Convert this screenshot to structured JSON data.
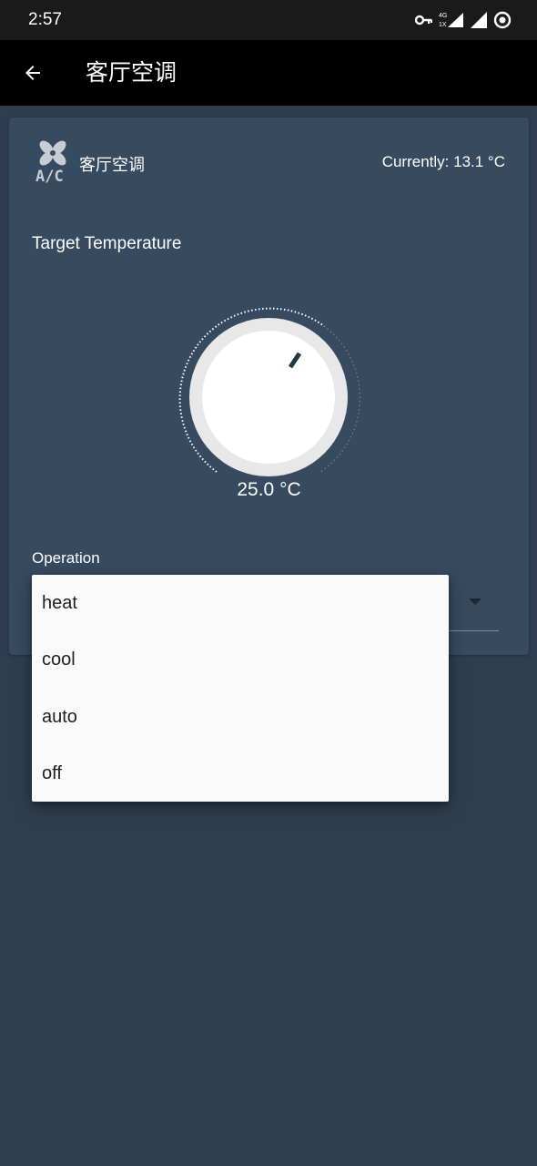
{
  "status_bar": {
    "time": "2:57",
    "icons": [
      "vpn-key-icon",
      "signal-4g-icon",
      "signal-icon",
      "circle-dot-icon"
    ]
  },
  "app_bar": {
    "title": "客厅空调",
    "back_icon": "arrow-back-icon"
  },
  "card": {
    "entity_name": "客厅空调",
    "current_temperature": "Currently: 13.1 °C",
    "target_label": "Target Temperature",
    "target_value": "25.0 °C",
    "operation_label": "Operation",
    "ac_icon": "air-conditioner-icon"
  },
  "operation_menu": {
    "options": [
      "heat",
      "cool",
      "auto",
      "off"
    ]
  },
  "colors": {
    "background": "#2e3e50",
    "card": "#364a60",
    "app_bar": "#000000",
    "dial_indicator": "#1c3a4a",
    "menu": "#fafafa"
  }
}
